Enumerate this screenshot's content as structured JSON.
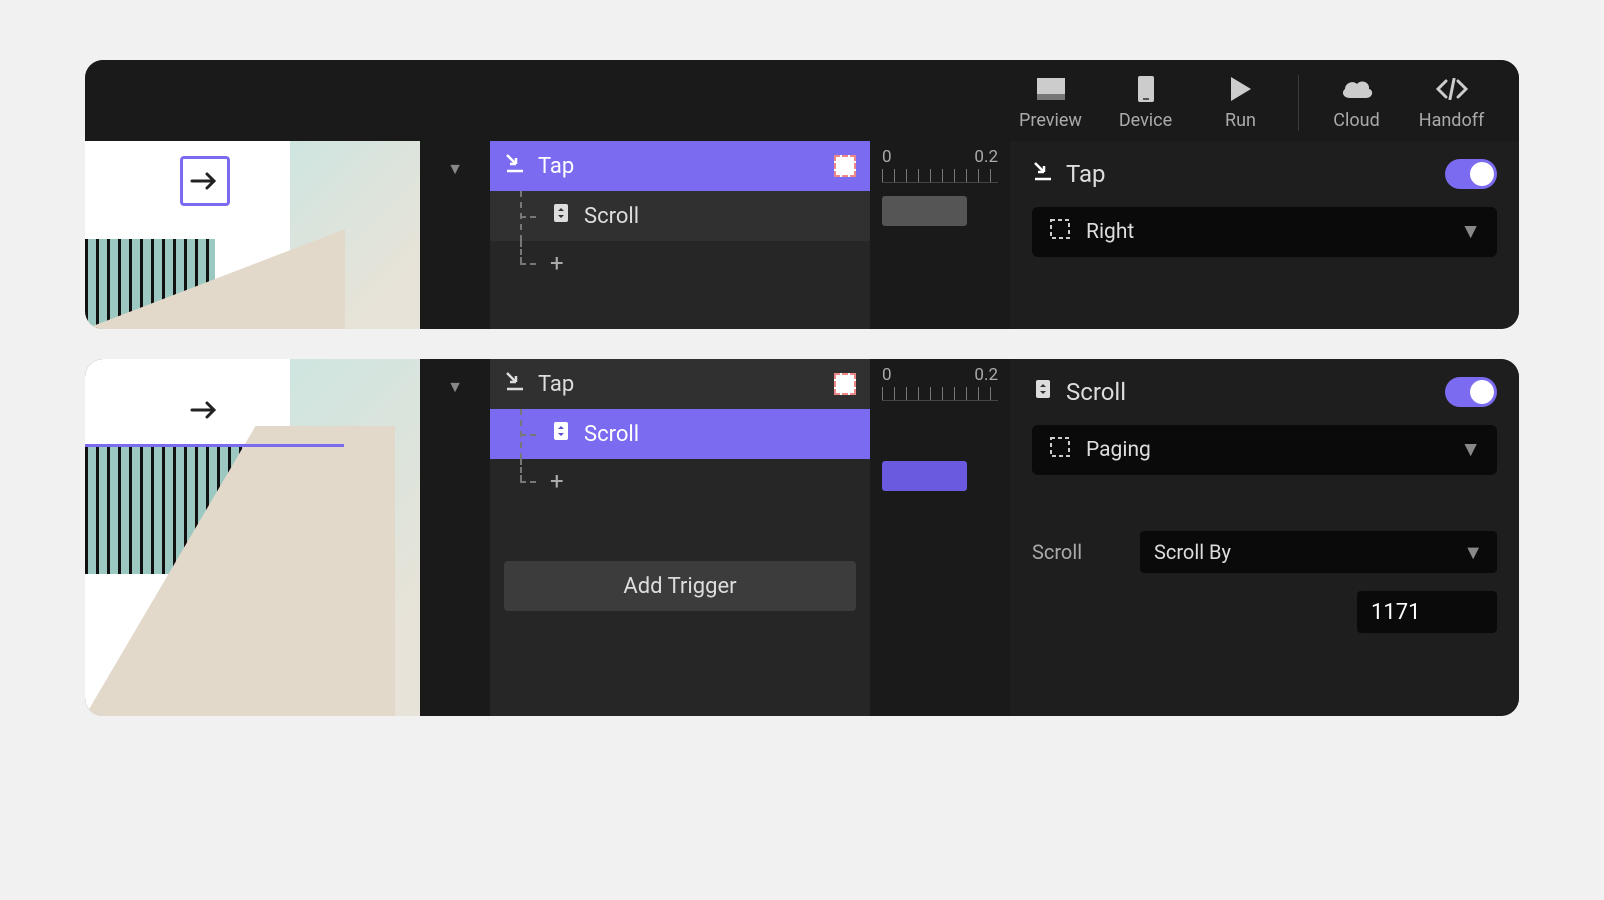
{
  "toolbar": {
    "preview": "Preview",
    "device": "Device",
    "run": "Run",
    "cloud": "Cloud",
    "handoff": "Handoff"
  },
  "panel1": {
    "layers": {
      "tap": "Tap",
      "scroll": "Scroll"
    },
    "ruler": {
      "start": "0",
      "end": "0.2"
    },
    "inspector": {
      "title": "Tap",
      "target": "Right"
    }
  },
  "panel2": {
    "layers": {
      "tap": "Tap",
      "scroll": "Scroll",
      "addTrigger": "Add Trigger"
    },
    "ruler": {
      "start": "0",
      "end": "0.2"
    },
    "inspector": {
      "title": "Scroll",
      "target": "Paging",
      "scrollLabel": "Scroll",
      "scrollMode": "Scroll By",
      "scrollValue": "1171"
    }
  }
}
